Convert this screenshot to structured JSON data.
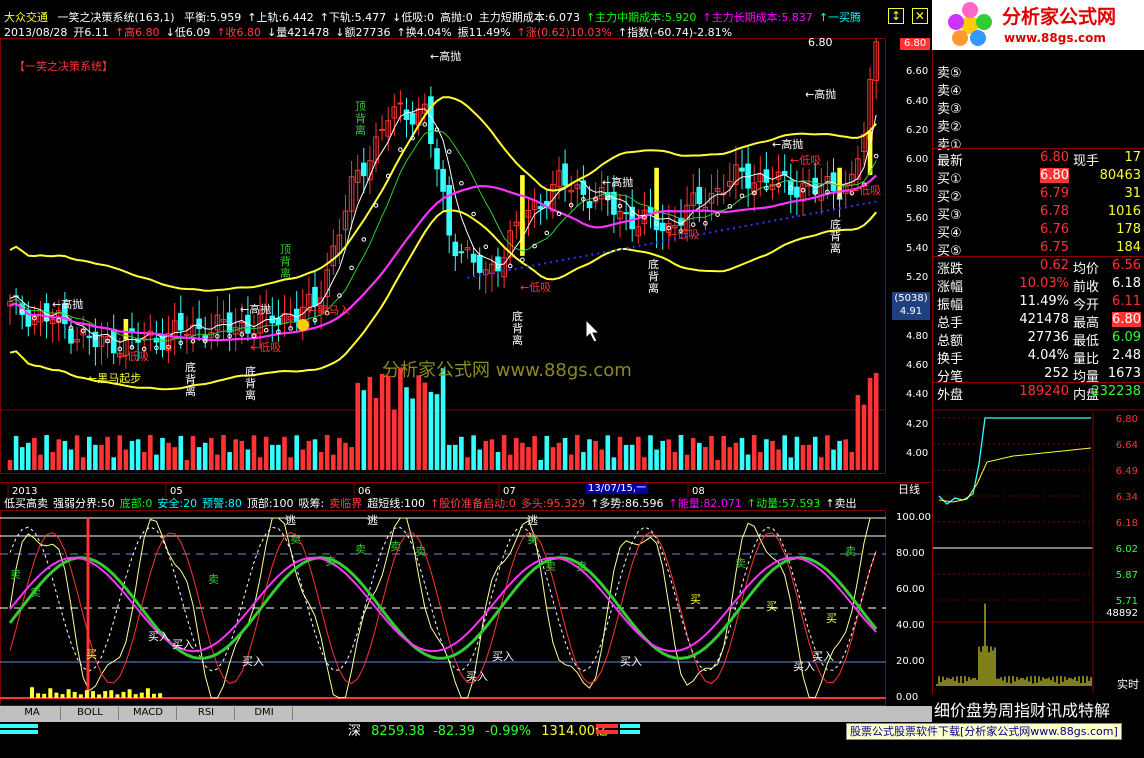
{
  "window": {
    "stock_name": "大众交通",
    "formula_name": "一笑之决策系统(163,1)",
    "indicators": [
      {
        "label": "平衡:5.959",
        "color": "#ffffff"
      },
      {
        "label": "↑上轨:6.442",
        "color": "#ffffff"
      },
      {
        "label": "↑下轨:5.477",
        "color": "#ffffff"
      },
      {
        "label": "↓低吸:0",
        "color": "#ffffff"
      },
      {
        "label": "高抛:0",
        "color": "#ffffff"
      },
      {
        "label": "主力短期成本:6.073",
        "color": "#ffffff"
      },
      {
        "label": "↑主力中期成本:5.920",
        "color": "#00ff00"
      },
      {
        "label": "↑主力长期成本:5.837",
        "color": "#ff00ff"
      },
      {
        "label": "↑一买腾",
        "color": "#00ffff"
      }
    ],
    "ohlc_row": [
      {
        "label": "2013/08/28",
        "color": "#ffffff"
      },
      {
        "label": "开6.11",
        "color": "#ffffff"
      },
      {
        "label": "↑高6.80",
        "color": "#ff4040"
      },
      {
        "label": "↓低6.09",
        "color": "#ffffff"
      },
      {
        "label": "↑收6.80",
        "color": "#ff4040"
      },
      {
        "label": "↓量421478",
        "color": "#ffffff"
      },
      {
        "label": "↓额27736",
        "color": "#ffffff"
      },
      {
        "label": "↑换4.04%",
        "color": "#ffffff"
      },
      {
        "label": "振11.49%",
        "color": "#ffffff"
      },
      {
        "label": "↑涨(0.62)10.03%",
        "color": "#ff4040"
      },
      {
        "label": "↑指数(-60.74)-2.81%",
        "color": "#ffffff"
      }
    ],
    "system_label": "【一笑之决策系统】",
    "watermark": "分析家公式网 www.88gs.com",
    "window_controls": [
      "↕",
      "✕"
    ]
  },
  "price_axis": {
    "ticks": [
      "6.80",
      "6.60",
      "6.40",
      "6.20",
      "6.00",
      "5.80",
      "5.60",
      "5.40",
      "5.20",
      "5.00",
      "4.80",
      "4.60",
      "4.40",
      "4.20",
      "4.00"
    ],
    "current_price": "6.80",
    "tag_top": "6.80",
    "info_box": [
      "(5038)",
      "4.91"
    ]
  },
  "chart_annotations": {
    "gaopao": "高抛",
    "dixi": "低吸",
    "dingbeili": "顶背离",
    "dibeili": "底背离",
    "heima": "黑马起步",
    "heima2": "黑马入",
    "candle_high": "6.80"
  },
  "date_axis": {
    "labels": [
      "2013",
      "05",
      "06",
      "07",
      "08"
    ],
    "highlight": "13/07/15,一",
    "period": "日线"
  },
  "indicator_panel": {
    "header": [
      {
        "label": "低买高卖",
        "color": "#ffffff"
      },
      {
        "label": "强弱分界:50",
        "color": "#ffffff"
      },
      {
        "label": "底部:0",
        "color": "#00ff00"
      },
      {
        "label": "安全:20",
        "color": "#00ffff"
      },
      {
        "label": "预警:80",
        "color": "#00ffff"
      },
      {
        "label": "顶部:100",
        "color": "#ffffff"
      },
      {
        "label": "吸筹:",
        "color": "#ffffff"
      },
      {
        "label": "卖临界",
        "color": "#ff4040"
      },
      {
        "label": "超短线:100",
        "color": "#ffffff"
      },
      {
        "label": "↑股价准备启动:0",
        "color": "#ff4040"
      },
      {
        "label": "多头:95.329",
        "color": "#ff4040"
      },
      {
        "label": "↑多势:86.596",
        "color": "#ffffff"
      },
      {
        "label": "↑能量:82.071",
        "color": "#ff00ff"
      },
      {
        "label": "↑动量:57.593",
        "color": "#00ff00"
      },
      {
        "label": "↑卖出",
        "color": "#ffffff"
      }
    ],
    "axis": [
      "100.00",
      "80.00",
      "60.00",
      "40.00",
      "20.00",
      "0.00"
    ],
    "buy_label": "买入",
    "sell_label": "卖",
    "escape_label": "逃",
    "buy_short": "买"
  },
  "tabs": [
    "MA",
    "BOLL",
    "MACD",
    "RSI",
    "DMI"
  ],
  "status_bar": {
    "index_name": "深",
    "index_value": "8259.38",
    "change": "-82.39",
    "percent": "-0.99%",
    "turnover": "1314.00亿",
    "right_text": "细价盘势周指财讯成特解",
    "ad_text": "股票公式股票软件下载[分析家公式网www.88gs.com]"
  },
  "logo": {
    "text": "分析家公式网",
    "url": "www.88gs.com"
  },
  "quote": {
    "asks": [
      {
        "label": "卖⑤"
      },
      {
        "label": "卖④"
      },
      {
        "label": "卖③"
      },
      {
        "label": "卖②"
      },
      {
        "label": "卖①"
      }
    ],
    "latest_label": "最新",
    "latest": "6.80",
    "now_label": "现手",
    "now": "17",
    "bids": [
      {
        "label": "买①",
        "price": "6.80",
        "vol": "80463"
      },
      {
        "label": "买②",
        "price": "6.79",
        "vol": "31"
      },
      {
        "label": "买③",
        "price": "6.78",
        "vol": "1016"
      },
      {
        "label": "买④",
        "price": "6.76",
        "vol": "178"
      },
      {
        "label": "买⑤",
        "price": "6.75",
        "vol": "184"
      }
    ],
    "stats": [
      {
        "l": "涨跌",
        "v": "0.62",
        "l2": "均价",
        "v2": "6.56"
      },
      {
        "l": "涨幅",
        "v": "10.03%",
        "l2": "前收",
        "v2": "6.18"
      },
      {
        "l": "振幅",
        "v": "11.49%",
        "l2": "今开",
        "v2": "6.11"
      },
      {
        "l": "总手",
        "v": "421478",
        "l2": "最高",
        "v2": "6.80"
      },
      {
        "l": "总额",
        "v": "27736",
        "l2": "最低",
        "v2": "6.09"
      },
      {
        "l": "换手",
        "v": "4.04%",
        "l2": "量比",
        "v2": "2.48"
      },
      {
        "l": "分笔",
        "v": "252",
        "l2": "均量",
        "v2": "1673"
      }
    ],
    "outer_label": "外盘",
    "outer": "189240",
    "inner_label": "内盘",
    "inner": "232238",
    "date": "2013/08/28"
  },
  "mini_chart": {
    "ticks": [
      "6.80",
      "6.64",
      "6.49",
      "6.34",
      "6.18",
      "6.02",
      "5.87",
      "5.71"
    ],
    "vol_top": "48892",
    "realtime": "实时"
  },
  "colors": {
    "up": "#ff3333",
    "down": "#33ffff",
    "yellow": "#ffff33",
    "magenta": "#ff33ff",
    "green": "#33cc33",
    "white": "#ffffff"
  }
}
